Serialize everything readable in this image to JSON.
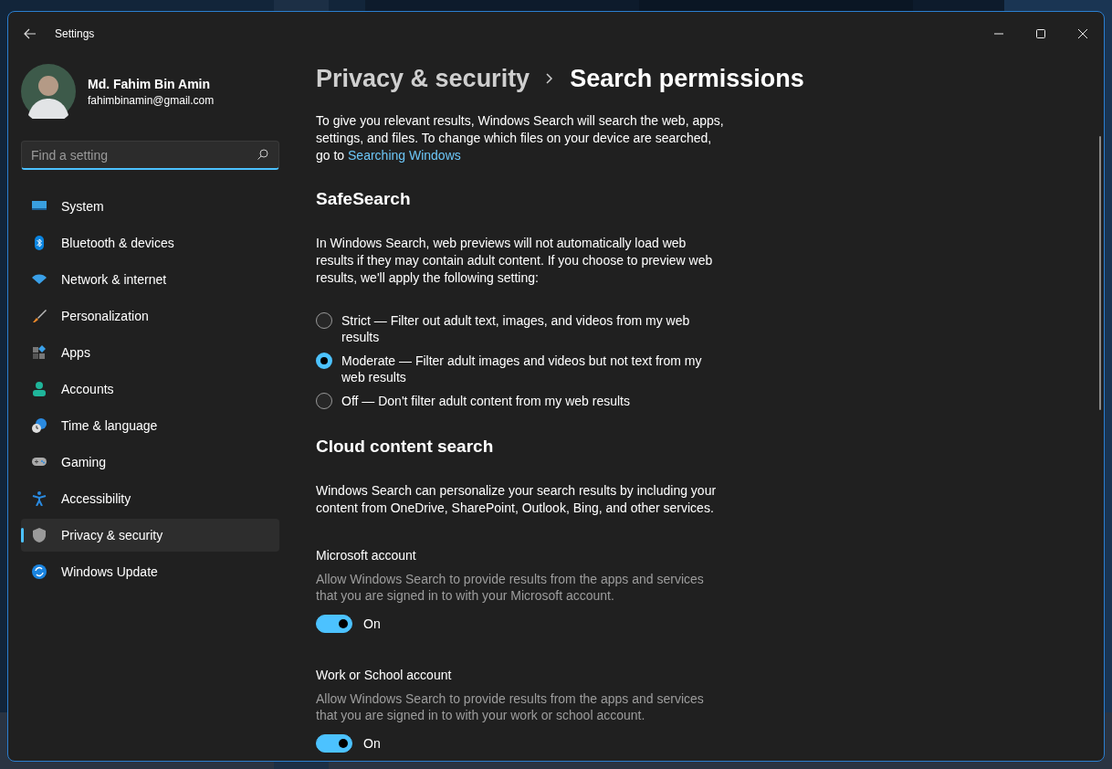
{
  "window": {
    "title": "Settings"
  },
  "profile": {
    "name": "Md. Fahim Bin Amin",
    "email": "fahimbinamin@gmail.com"
  },
  "search": {
    "placeholder": "Find a setting"
  },
  "nav": [
    {
      "label": "System",
      "selected": false
    },
    {
      "label": "Bluetooth & devices",
      "selected": false
    },
    {
      "label": "Network & internet",
      "selected": false
    },
    {
      "label": "Personalization",
      "selected": false
    },
    {
      "label": "Apps",
      "selected": false
    },
    {
      "label": "Accounts",
      "selected": false
    },
    {
      "label": "Time & language",
      "selected": false
    },
    {
      "label": "Gaming",
      "selected": false
    },
    {
      "label": "Accessibility",
      "selected": false
    },
    {
      "label": "Privacy & security",
      "selected": true
    },
    {
      "label": "Windows Update",
      "selected": false
    }
  ],
  "breadcrumb": {
    "parent": "Privacy & security",
    "current": "Search permissions"
  },
  "intro": {
    "text": "To give you relevant results, Windows Search will search the web, apps, settings, and files. To change which files on your device are searched, go to",
    "link": "Searching Windows"
  },
  "safesearch": {
    "heading": "SafeSearch",
    "description": "In Windows Search, web previews will not automatically load web results if they may contain adult content. If you choose to preview web results, we'll apply the following setting:",
    "options": [
      {
        "label": "Strict — Filter out adult text, images, and videos from my web results",
        "selected": false
      },
      {
        "label": "Moderate — Filter adult images and videos but not text from my web results",
        "selected": true
      },
      {
        "label": "Off — Don't filter adult content from my web results",
        "selected": false
      }
    ]
  },
  "cloud": {
    "heading": "Cloud content search",
    "description": "Windows Search can personalize your search results by including your content from OneDrive, SharePoint, Outlook, Bing, and other services.",
    "accounts": [
      {
        "title": "Microsoft account",
        "description": "Allow Windows Search to provide results from the apps and services that you are signed in to with your Microsoft account.",
        "on": true,
        "state_label": "On"
      },
      {
        "title": "Work or School account",
        "description": "Allow Windows Search to provide results from the apps and services that you are signed in to with your work or school account.",
        "on": true,
        "state_label": "On"
      }
    ]
  }
}
